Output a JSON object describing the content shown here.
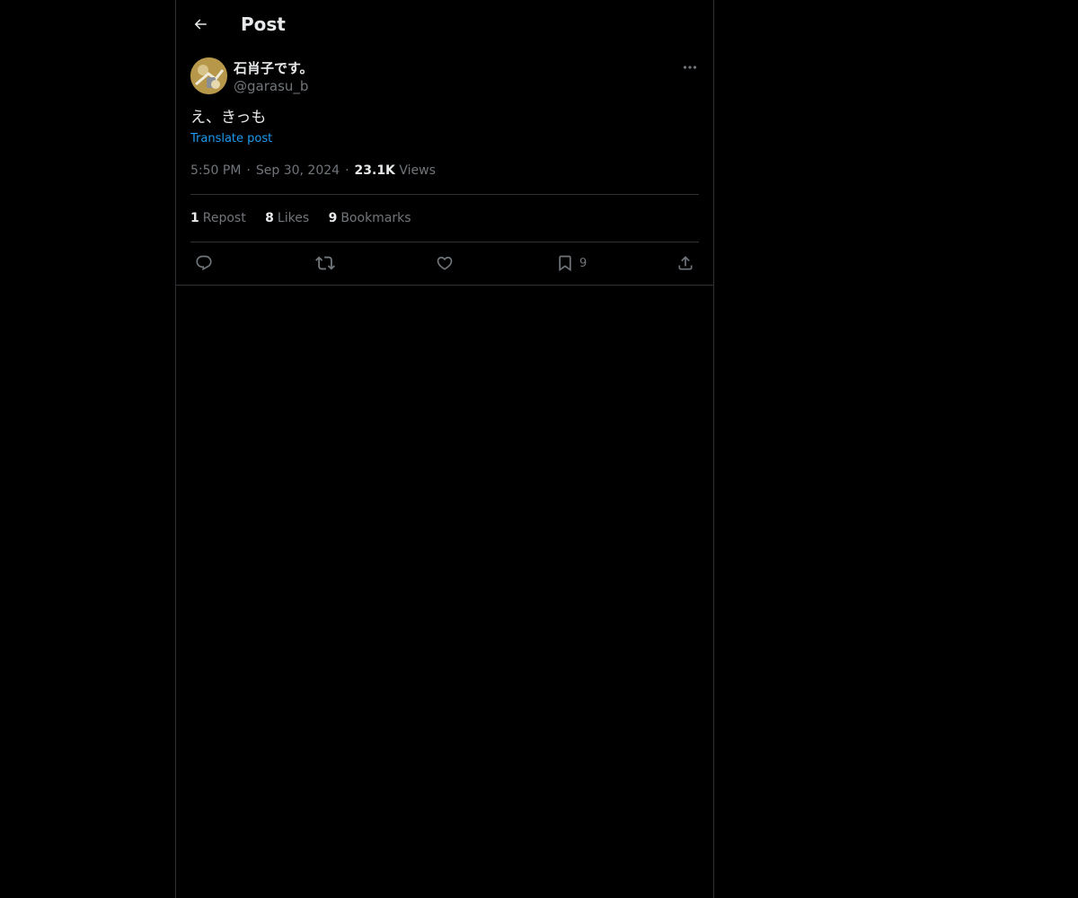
{
  "header": {
    "title": "Post",
    "back_icon": "arrow-left-icon"
  },
  "post": {
    "display_name": "石肖子です。",
    "handle": "@garasu_b",
    "text": "え、きっも",
    "translate_label": "Translate post",
    "time": "5:50 PM",
    "date": "Sep 30, 2024",
    "views_count": "23.1K",
    "views_label": "Views",
    "more_icon": "more-horizontal-icon"
  },
  "stats": {
    "reposts_count": "1",
    "reposts_label": "Repost",
    "likes_count": "8",
    "likes_label": "Likes",
    "bookmarks_count": "9",
    "bookmarks_label": "Bookmarks"
  },
  "actions": {
    "reply_icon": "reply-icon",
    "repost_icon": "repost-icon",
    "like_icon": "heart-icon",
    "bookmark_icon": "bookmark-icon",
    "bookmark_count": "9",
    "share_icon": "share-icon"
  },
  "colors": {
    "background": "#000000",
    "text_primary": "#e7e9ea",
    "text_secondary": "#71767b",
    "link": "#1d9bf0",
    "border": "#2f3336"
  }
}
